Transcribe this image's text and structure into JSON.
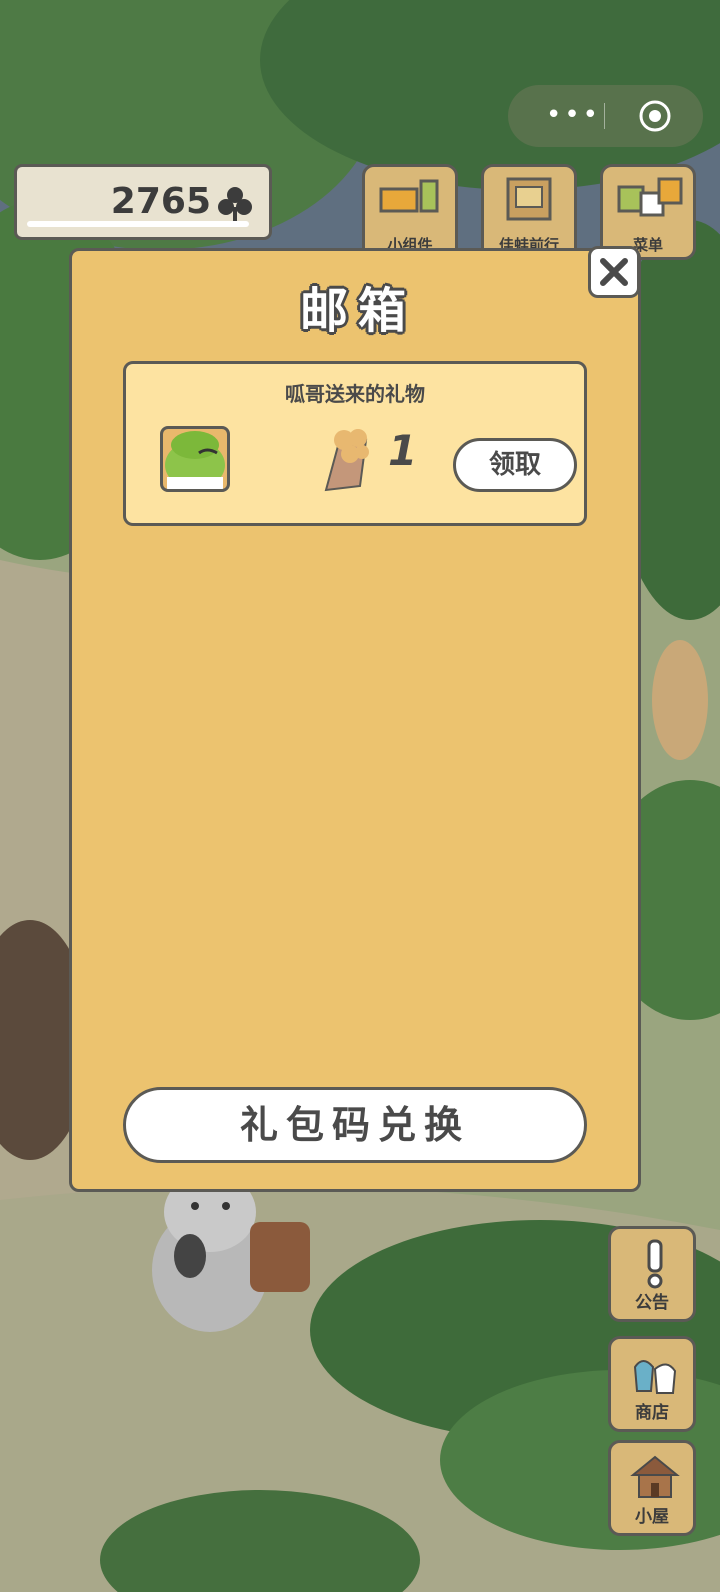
{
  "currency": {
    "amount": "2765"
  },
  "top_buttons": [
    {
      "label": "小组件",
      "icon": "widget-icon"
    },
    {
      "label": "佳蛙前行",
      "icon": "book-icon"
    },
    {
      "label": "菜单",
      "icon": "menu-cards-icon"
    }
  ],
  "mailbox": {
    "title": "邮箱",
    "mail": {
      "from": "呱哥送来的礼物",
      "item_icon": "waffle-icon",
      "quantity": "1",
      "claim_label": "领取"
    },
    "redeem_label": "礼包码兑换"
  },
  "side_buttons": [
    {
      "label": "公告",
      "icon": "exclamation-icon"
    },
    {
      "label": "商店",
      "icon": "shop-bags-icon"
    },
    {
      "label": "小屋",
      "icon": "house-icon"
    }
  ],
  "colors": {
    "panel": "#ecc36f",
    "card": "#fde3a1",
    "outline": "#5b5a55"
  }
}
